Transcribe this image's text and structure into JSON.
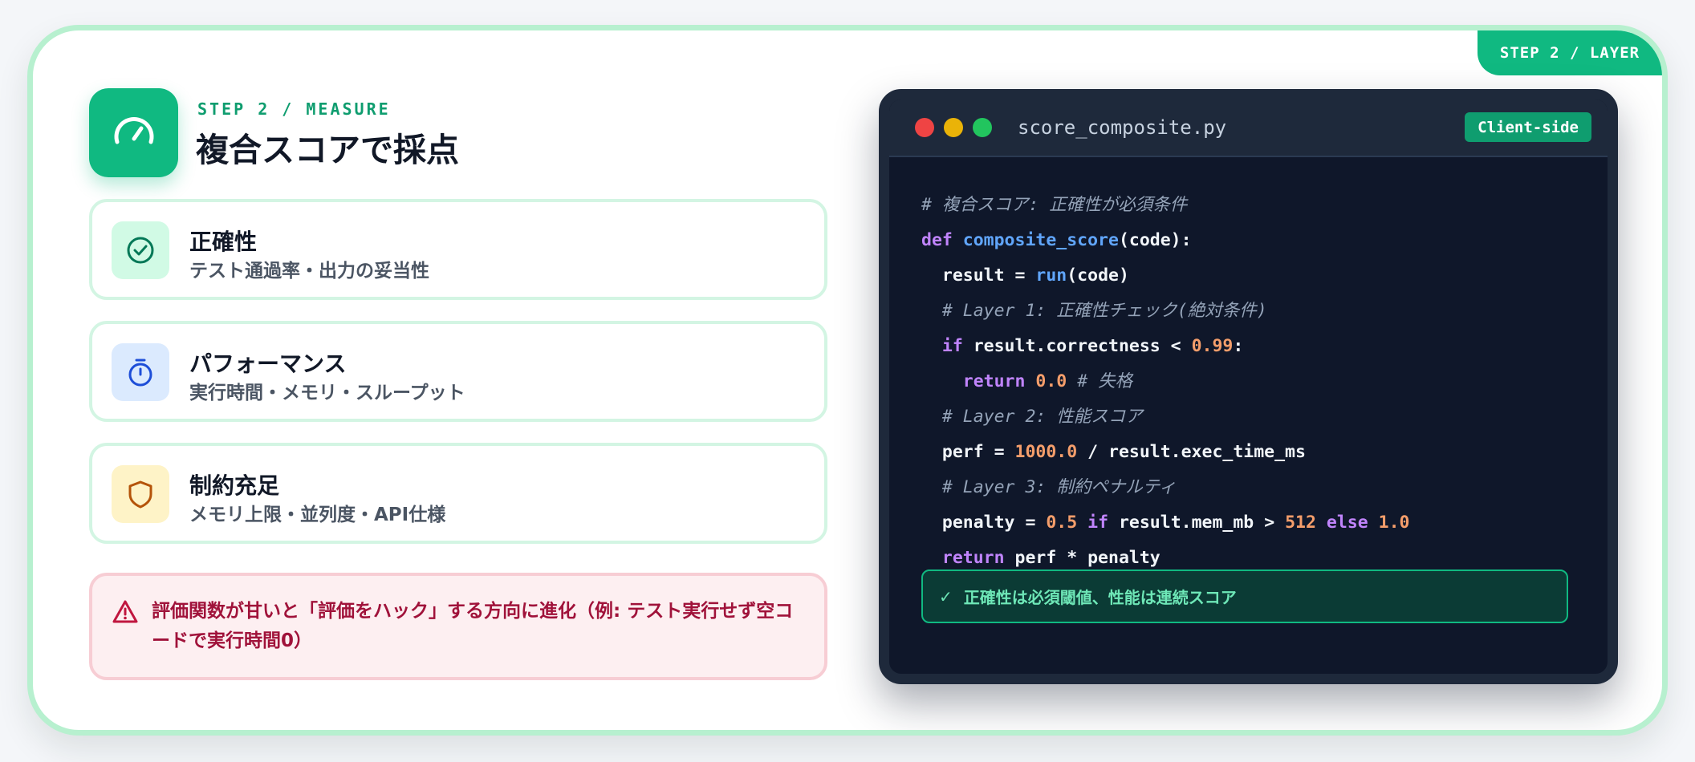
{
  "corner_tag": "STEP 2 / LAYER",
  "header": {
    "eyebrow": "STEP 2 / MEASURE",
    "title": "複合スコアで採点",
    "icon": "gauge-icon"
  },
  "criteria": [
    {
      "title": "正確性",
      "subtitle": "テスト通過率・出力の妥当性",
      "icon": "check-circle-icon",
      "icon_bg": "#d1fae5",
      "icon_color": "#047857"
    },
    {
      "title": "パフォーマンス",
      "subtitle": "実行時間・メモリ・スループット",
      "icon": "stopwatch-icon",
      "icon_bg": "#dbeafe",
      "icon_color": "#1d4ed8"
    },
    {
      "title": "制約充足",
      "subtitle": "メモリ上限・並列度・API仕様",
      "icon": "shield-icon",
      "icon_bg": "#fef3c7",
      "icon_color": "#b45309"
    }
  ],
  "warning": {
    "icon": "warning-triangle-icon",
    "text": "評価関数が甘いと「評価をハック」する方向に進化（例: テスト実行せず空コードで実行時間0）"
  },
  "code_window": {
    "filename": "score_composite.py",
    "badge": "Client-side",
    "lines": [
      [
        {
          "t": "# 複合スコア: 正確性が必須条件",
          "c": "comment"
        }
      ],
      [
        {
          "t": "def ",
          "c": "kw"
        },
        {
          "t": "composite_score",
          "c": "fn"
        },
        {
          "t": "(code):",
          "c": "plain"
        }
      ],
      [
        {
          "t": "  result = ",
          "c": "plain"
        },
        {
          "t": "run",
          "c": "fn"
        },
        {
          "t": "(code)",
          "c": "plain"
        }
      ],
      [
        {
          "t": "  # Layer 1: 正確性チェック(絶対条件)",
          "c": "comment"
        }
      ],
      [
        {
          "t": "  ",
          "c": "plain"
        },
        {
          "t": "if",
          "c": "kw"
        },
        {
          "t": " result.correctness < ",
          "c": "plain"
        },
        {
          "t": "0.99",
          "c": "num"
        },
        {
          "t": ":",
          "c": "plain"
        }
      ],
      [
        {
          "t": "    ",
          "c": "plain"
        },
        {
          "t": "return",
          "c": "kw"
        },
        {
          "t": " ",
          "c": "plain"
        },
        {
          "t": "0.0",
          "c": "num"
        },
        {
          "t": " # 失格",
          "c": "comment"
        }
      ],
      [
        {
          "t": "  # Layer 2: 性能スコア",
          "c": "comment"
        }
      ],
      [
        {
          "t": "  perf = ",
          "c": "plain"
        },
        {
          "t": "1000.0",
          "c": "num"
        },
        {
          "t": " / result.exec_time_ms",
          "c": "plain"
        }
      ],
      [
        {
          "t": "  # Layer 3: 制約ペナルティ",
          "c": "comment"
        }
      ],
      [
        {
          "t": "  penalty = ",
          "c": "plain"
        },
        {
          "t": "0.5",
          "c": "num"
        },
        {
          "t": " ",
          "c": "plain"
        },
        {
          "t": "if",
          "c": "kw"
        },
        {
          "t": " result.mem_mb > ",
          "c": "plain"
        },
        {
          "t": "512",
          "c": "num"
        },
        {
          "t": " ",
          "c": "plain"
        },
        {
          "t": "else",
          "c": "kw"
        },
        {
          "t": " ",
          "c": "plain"
        },
        {
          "t": "1.0",
          "c": "num"
        }
      ],
      [
        {
          "t": "  ",
          "c": "plain"
        },
        {
          "t": "return",
          "c": "kw"
        },
        {
          "t": " perf * penalty",
          "c": "plain"
        }
      ]
    ],
    "note": "正確性は必須閾値、性能は連続スコア",
    "note_icon": "checkmark-icon"
  },
  "colors": {
    "accent": "#10b981",
    "card_border": "#b7f0cf",
    "warning_text": "#a0123a",
    "code_bg": "#0f172a"
  }
}
